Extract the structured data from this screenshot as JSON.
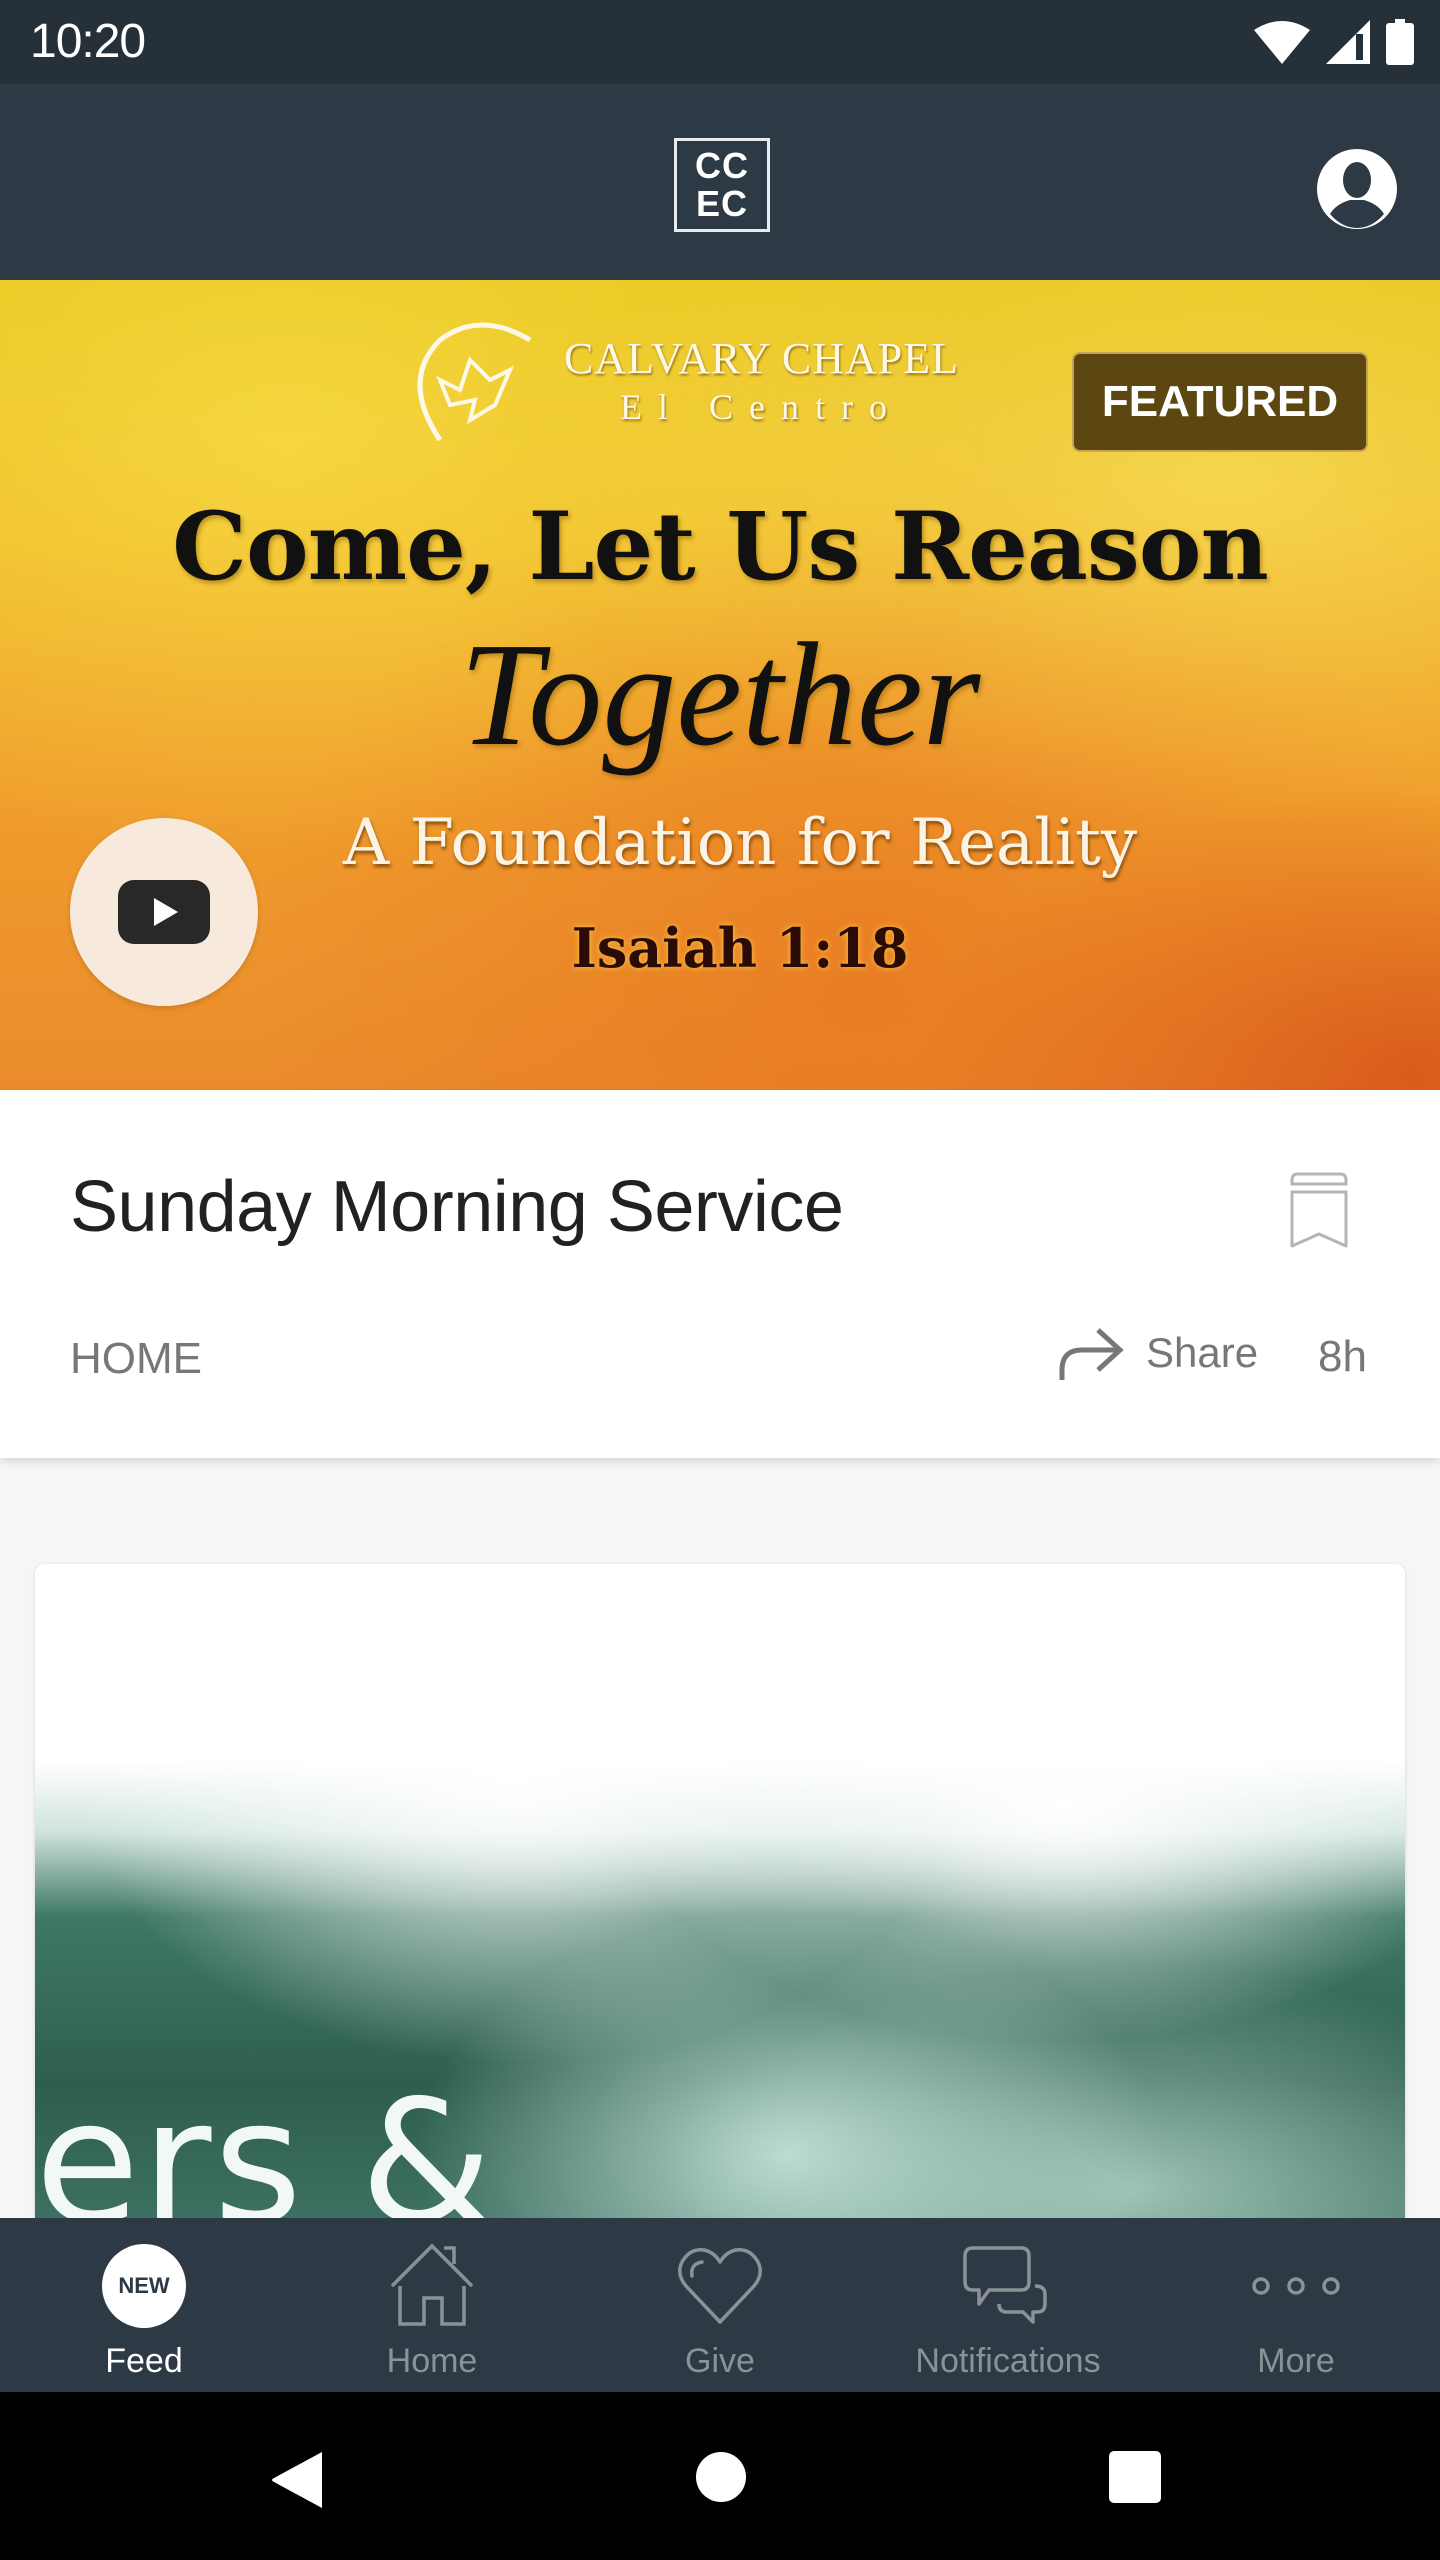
{
  "status_bar": {
    "time": "10:20",
    "icons": [
      "wifi-icon",
      "cell-signal-icon",
      "battery-icon"
    ]
  },
  "app_bar": {
    "logo_line1": "CC",
    "logo_line2": "EC",
    "profile_icon": "account-circle-icon"
  },
  "featured": {
    "badge": "FEATURED",
    "church_name_line1": "CALVARY CHAPEL",
    "church_name_line2": "El Centro",
    "title": "Come, Let Us Reason",
    "title_script": "Together",
    "subtitle": "A Foundation for Reality",
    "verse": "Isaiah 1:18",
    "media_icon": "youtube-play-icon",
    "post": {
      "title": "Sunday Morning Service",
      "category": "HOME",
      "share_label": "Share",
      "age": "8h",
      "bookmark_icon": "bookmark-icon",
      "share_icon": "share-arrow-icon"
    }
  },
  "next_card": {
    "image_text": "ers &"
  },
  "bottom_nav": {
    "items": [
      {
        "label": "Feed",
        "icon": "new-badge-icon",
        "badge": "NEW",
        "active": true
      },
      {
        "label": "Home",
        "icon": "house-icon",
        "active": false
      },
      {
        "label": "Give",
        "icon": "heart-icon",
        "active": false
      },
      {
        "label": "Notifications",
        "icon": "chat-bubbles-icon",
        "active": false
      },
      {
        "label": "More",
        "icon": "more-dots-icon",
        "active": false
      }
    ]
  },
  "system_nav": [
    "back-icon",
    "home-circle-icon",
    "recents-icon"
  ],
  "colors": {
    "app_bar": "#2d3a45",
    "status_bar": "#263039",
    "featured_badge": "#5d4710",
    "inactive_nav": "#8b9297",
    "meta_text": "#777777"
  }
}
